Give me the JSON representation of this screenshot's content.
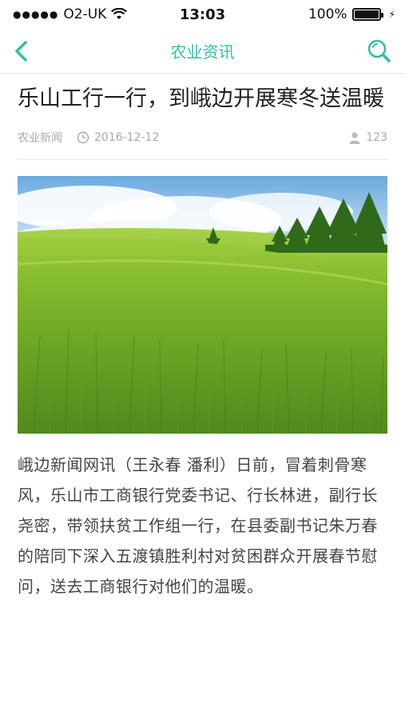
{
  "status": {
    "carrier": "O2-UK",
    "time": "13:03",
    "battery": "100%"
  },
  "nav": {
    "title": "农业资讯"
  },
  "article": {
    "title": "乐山工行一行，到峨边开展寒冬送温暖",
    "category": "农业新闻",
    "date": "2016-12-12",
    "views": "123",
    "body": "峨边新闻网讯（王永春 潘利）日前，冒着刺骨寒风，乐山市工商银行党委书记、行长林进，副行长尧密，带领扶贫工作组一行，在县委副书记朱万春的陪同下深入五渡镇胜利村对贫困群众开展春节慰问，送去工商银行对他们的温暖。"
  },
  "colors": {
    "accent": "#2fbfa8"
  },
  "icons": {
    "back": "chevron-left-icon",
    "search": "search-icon",
    "clock": "clock-icon",
    "user": "user-icon",
    "wifi": "wifi-icon"
  }
}
